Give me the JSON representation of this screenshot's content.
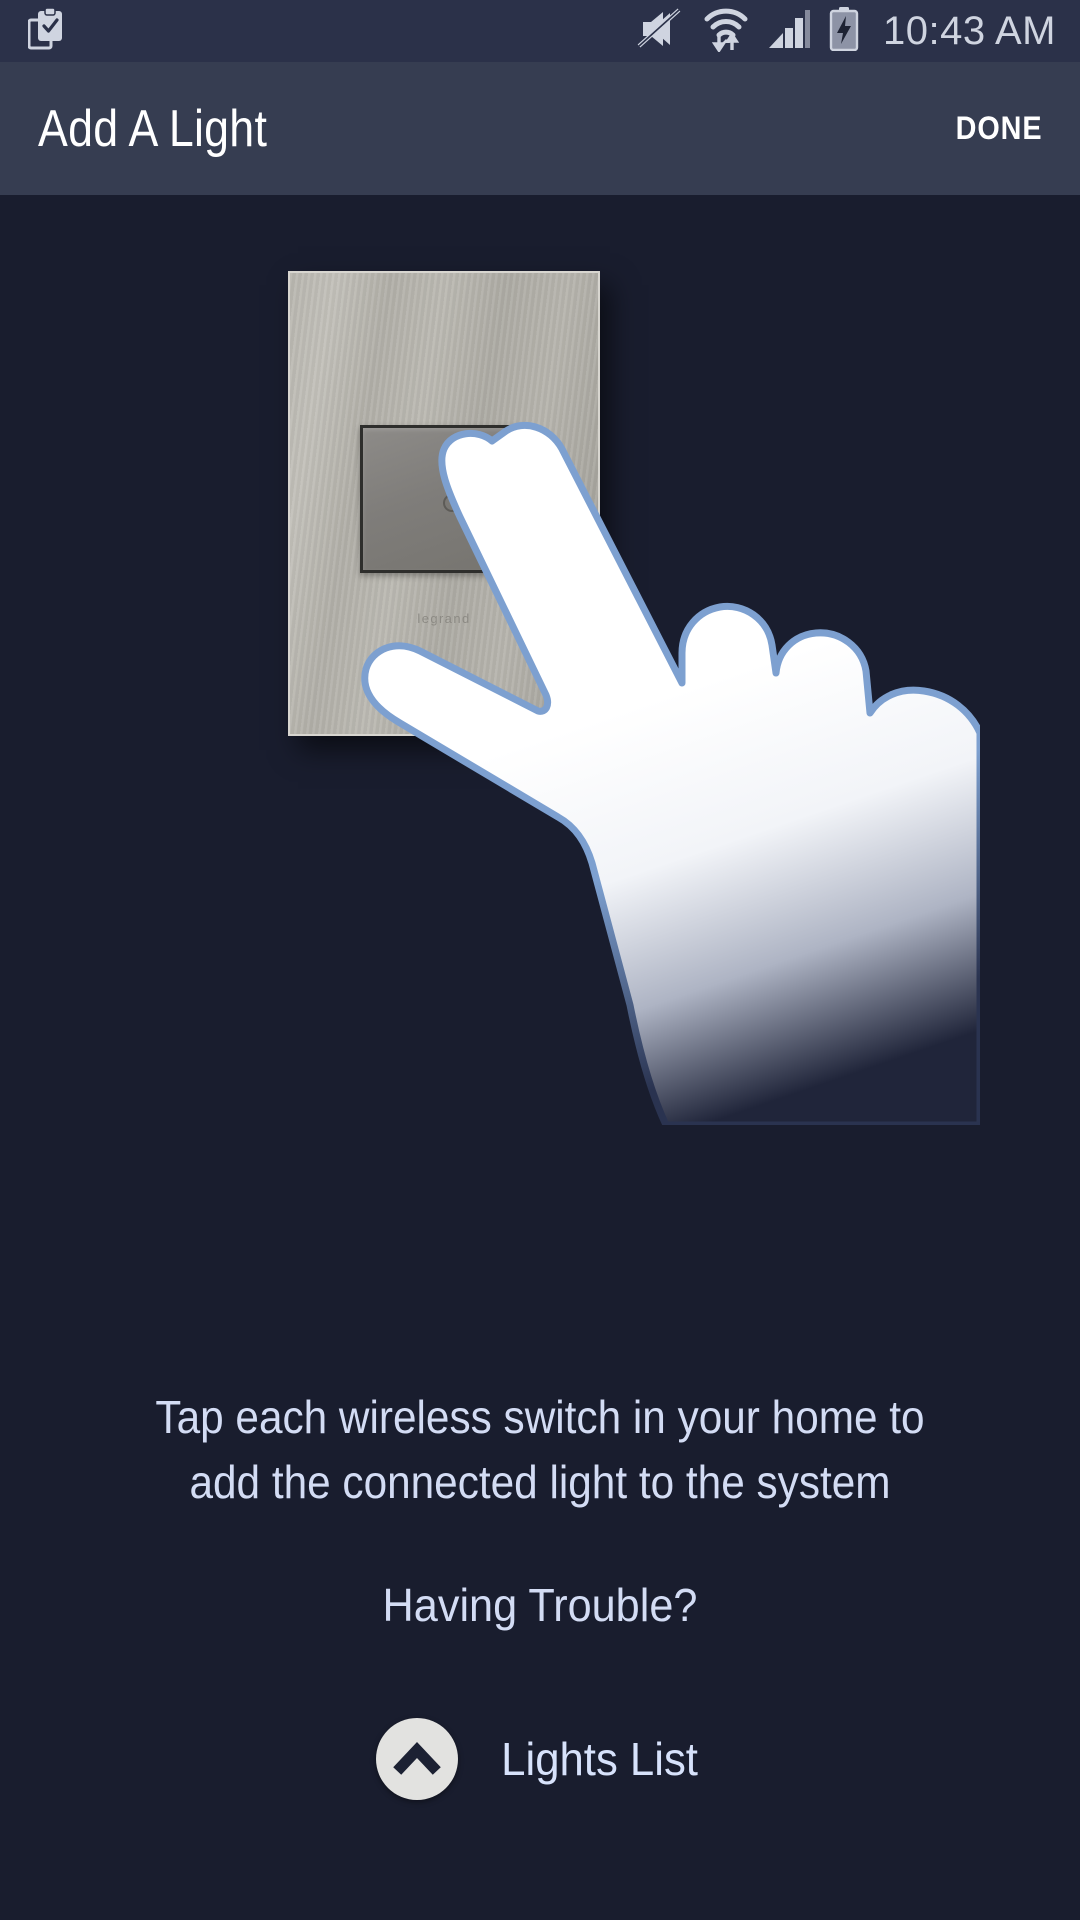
{
  "statusbar": {
    "time": "10:43 AM",
    "icons": [
      {
        "name": "task-checklist-icon",
        "position": "left"
      },
      {
        "name": "sound-muted-icon",
        "position": "right"
      },
      {
        "name": "wifi-data-transfer-icon",
        "position": "right"
      },
      {
        "name": "cellular-signal-icon",
        "position": "right"
      },
      {
        "name": "battery-charging-icon",
        "position": "right"
      }
    ]
  },
  "header": {
    "title": "Add A Light",
    "done_label": "DONE"
  },
  "illustration": {
    "switch_brand": "legrand",
    "alt": "hand tapping a wireless wall switch"
  },
  "content": {
    "instruction_line1": "Tap each wireless switch in your home to",
    "instruction_line2": "add the connected light to the system",
    "trouble_link": "Having Trouble?",
    "lights_list_label": "Lights List"
  },
  "colors": {
    "statusbar_bg": "#2b3149",
    "header_bg": "#363d51",
    "page_bg": "#191d2e",
    "text_light": "#d3dcf4",
    "accent_white": "#ffffff",
    "hand_outline": "#7da0d0",
    "plate_metal": "#b5b3ac"
  }
}
